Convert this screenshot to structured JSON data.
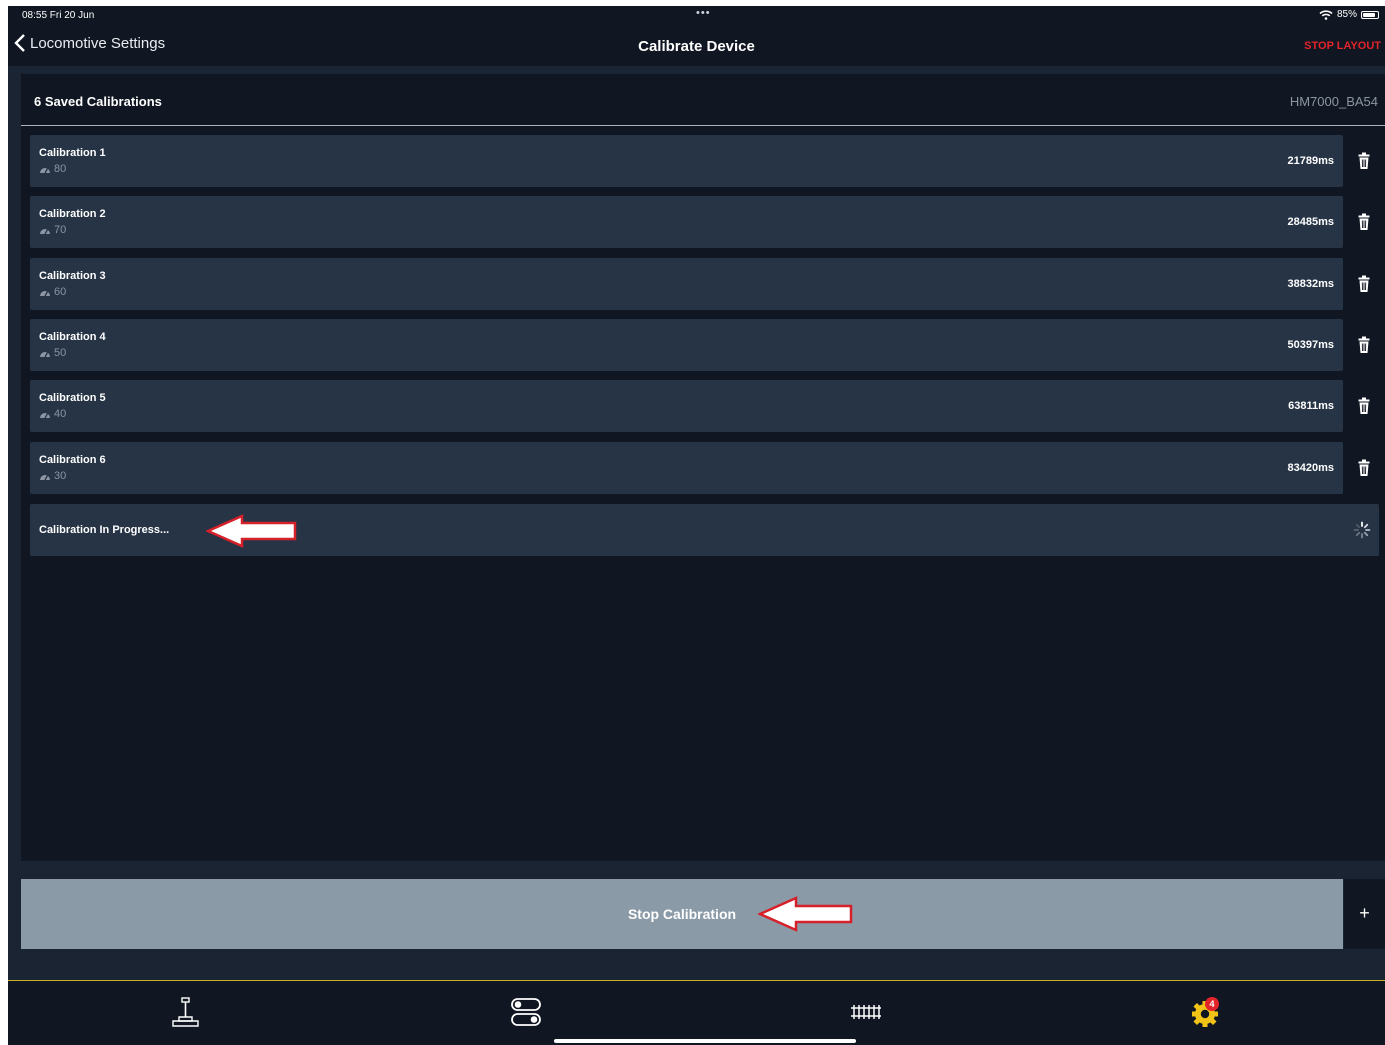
{
  "status": {
    "time": "08:55  Fri 20 Jun",
    "dots": "•••",
    "battery": "85%",
    "battery_level": 0.85
  },
  "nav": {
    "back_label": "Locomotive Settings",
    "title": "Calibrate Device",
    "stop_layout": "STOP LAYOUT"
  },
  "panel": {
    "saved_count": "6 Saved Calibrations",
    "device": "HM7000_BA54",
    "calibrations": [
      {
        "name": "Calibration 1",
        "speed": "80",
        "time": "21789ms"
      },
      {
        "name": "Calibration 2",
        "speed": "70",
        "time": "28485ms"
      },
      {
        "name": "Calibration 3",
        "speed": "60",
        "time": "38832ms"
      },
      {
        "name": "Calibration 4",
        "speed": "50",
        "time": "50397ms"
      },
      {
        "name": "Calibration 5",
        "speed": "40",
        "time": "63811ms"
      },
      {
        "name": "Calibration 6",
        "speed": "30",
        "time": "83420ms"
      }
    ],
    "progress_label": "Calibration In Progress..."
  },
  "actions": {
    "stop_calibration": "Stop Calibration",
    "add": "+"
  },
  "tabbar": {
    "badge": "4"
  },
  "colors": {
    "accent_red": "#e2242b",
    "accent_yellow": "#f2c418",
    "row_bg": "#263446",
    "panel_bg": "#101722"
  },
  "icons": [
    "chevron-left-icon",
    "wifi-icon",
    "battery-icon",
    "speedometer-icon",
    "trash-icon",
    "spinner-icon",
    "arrow-left-icon",
    "throttle-icon",
    "toggles-icon",
    "track-icon",
    "gear-icon"
  ]
}
